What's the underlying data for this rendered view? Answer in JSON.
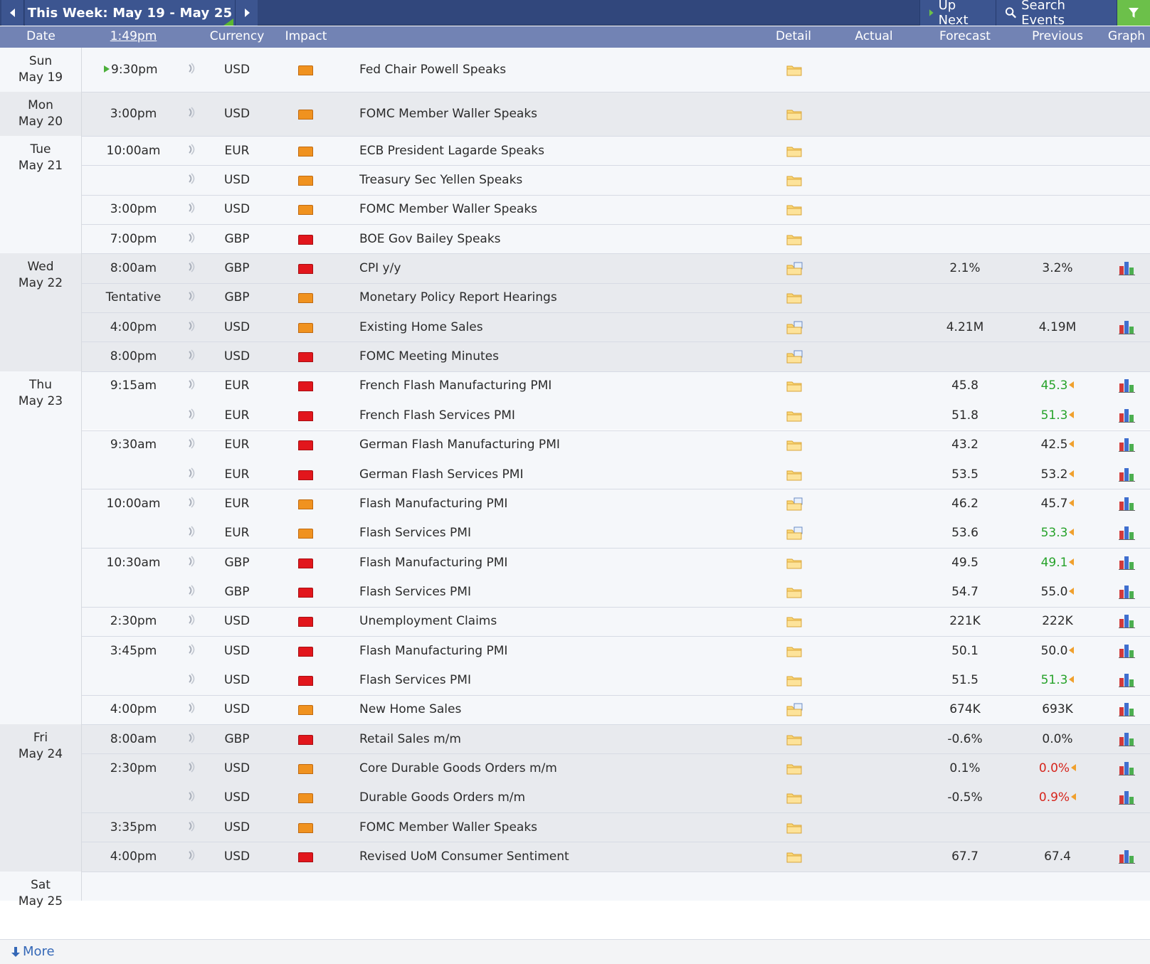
{
  "toolbar": {
    "week_title": "This Week: May 19 - May 25",
    "up_next_label": "Up Next",
    "search_label": "Search Events",
    "colors": {
      "bar": "#31477c",
      "filter": "#6cc04a",
      "header": "#7283b4"
    }
  },
  "header": {
    "date": "Date",
    "time": "1:49pm",
    "currency": "Currency",
    "impact": "Impact",
    "detail": "Detail",
    "actual": "Actual",
    "forecast": "Forecast",
    "previous": "Previous",
    "graph": "Graph"
  },
  "days": [
    {
      "dow": "Sun",
      "date": "May 19"
    },
    {
      "dow": "Mon",
      "date": "May 20"
    },
    {
      "dow": "Tue",
      "date": "May 21"
    },
    {
      "dow": "Wed",
      "date": "May 22"
    },
    {
      "dow": "Thu",
      "date": "May 23"
    },
    {
      "dow": "Fri",
      "date": "May 24"
    },
    {
      "dow": "Sat",
      "date": "May 25"
    }
  ],
  "events": [
    {
      "time": "9:30pm",
      "upcoming": true,
      "currency": "USD",
      "impact": "medium",
      "title": "Fed Chair Powell Speaks",
      "forecast": "",
      "previous": "",
      "previous_color": "",
      "revised": false,
      "graph": false
    },
    {
      "time": "3:00pm",
      "currency": "USD",
      "impact": "medium",
      "title": "FOMC Member Waller Speaks",
      "forecast": "",
      "previous": "",
      "previous_color": "",
      "revised": false,
      "graph": false
    },
    {
      "time": "10:00am",
      "currency": "EUR",
      "impact": "medium",
      "title": "ECB President Lagarde Speaks",
      "forecast": "",
      "previous": "",
      "previous_color": "",
      "revised": false,
      "graph": false
    },
    {
      "time": "",
      "currency": "USD",
      "impact": "medium",
      "title": "Treasury Sec Yellen Speaks",
      "forecast": "",
      "previous": "",
      "previous_color": "",
      "revised": false,
      "graph": false
    },
    {
      "time": "3:00pm",
      "currency": "USD",
      "impact": "medium",
      "title": "FOMC Member Waller Speaks",
      "forecast": "",
      "previous": "",
      "previous_color": "",
      "revised": false,
      "graph": false
    },
    {
      "time": "7:00pm",
      "currency": "GBP",
      "impact": "high",
      "title": "BOE Gov Bailey Speaks",
      "forecast": "",
      "previous": "",
      "previous_color": "",
      "revised": false,
      "graph": false
    },
    {
      "time": "8:00am",
      "currency": "GBP",
      "impact": "high",
      "title": "CPI y/y",
      "forecast": "2.1%",
      "previous": "3.2%",
      "previous_color": "",
      "revised": false,
      "graph": true
    },
    {
      "time": "Tentative",
      "currency": "GBP",
      "impact": "medium",
      "title": "Monetary Policy Report Hearings",
      "forecast": "",
      "previous": "",
      "previous_color": "",
      "revised": false,
      "graph": false
    },
    {
      "time": "4:00pm",
      "currency": "USD",
      "impact": "medium",
      "title": "Existing Home Sales",
      "forecast": "4.21M",
      "previous": "4.19M",
      "previous_color": "",
      "revised": false,
      "graph": true
    },
    {
      "time": "8:00pm",
      "currency": "USD",
      "impact": "high",
      "title": "FOMC Meeting Minutes",
      "forecast": "",
      "previous": "",
      "previous_color": "",
      "revised": false,
      "graph": false
    },
    {
      "time": "9:15am",
      "currency": "EUR",
      "impact": "high",
      "title": "French Flash Manufacturing PMI",
      "forecast": "45.8",
      "previous": "45.3",
      "previous_color": "green",
      "revised": true,
      "graph": true
    },
    {
      "time": "",
      "currency": "EUR",
      "impact": "high",
      "title": "French Flash Services PMI",
      "forecast": "51.8",
      "previous": "51.3",
      "previous_color": "green",
      "revised": true,
      "graph": true
    },
    {
      "time": "9:30am",
      "currency": "EUR",
      "impact": "high",
      "title": "German Flash Manufacturing PMI",
      "forecast": "43.2",
      "previous": "42.5",
      "previous_color": "",
      "revised": true,
      "graph": true
    },
    {
      "time": "",
      "currency": "EUR",
      "impact": "high",
      "title": "German Flash Services PMI",
      "forecast": "53.5",
      "previous": "53.2",
      "previous_color": "",
      "revised": true,
      "graph": true
    },
    {
      "time": "10:00am",
      "currency": "EUR",
      "impact": "medium",
      "title": "Flash Manufacturing PMI",
      "forecast": "46.2",
      "previous": "45.7",
      "previous_color": "",
      "revised": true,
      "graph": true
    },
    {
      "time": "",
      "currency": "EUR",
      "impact": "medium",
      "title": "Flash Services PMI",
      "forecast": "53.6",
      "previous": "53.3",
      "previous_color": "green",
      "revised": true,
      "graph": true
    },
    {
      "time": "10:30am",
      "currency": "GBP",
      "impact": "high",
      "title": "Flash Manufacturing PMI",
      "forecast": "49.5",
      "previous": "49.1",
      "previous_color": "green",
      "revised": true,
      "graph": true
    },
    {
      "time": "",
      "currency": "GBP",
      "impact": "high",
      "title": "Flash Services PMI",
      "forecast": "54.7",
      "previous": "55.0",
      "previous_color": "",
      "revised": true,
      "graph": true
    },
    {
      "time": "2:30pm",
      "currency": "USD",
      "impact": "high",
      "title": "Unemployment Claims",
      "forecast": "221K",
      "previous": "222K",
      "previous_color": "",
      "revised": false,
      "graph": true
    },
    {
      "time": "3:45pm",
      "currency": "USD",
      "impact": "high",
      "title": "Flash Manufacturing PMI",
      "forecast": "50.1",
      "previous": "50.0",
      "previous_color": "",
      "revised": true,
      "graph": true
    },
    {
      "time": "",
      "currency": "USD",
      "impact": "high",
      "title": "Flash Services PMI",
      "forecast": "51.5",
      "previous": "51.3",
      "previous_color": "green",
      "revised": true,
      "graph": true
    },
    {
      "time": "4:00pm",
      "currency": "USD",
      "impact": "medium",
      "title": "New Home Sales",
      "forecast": "674K",
      "previous": "693K",
      "previous_color": "",
      "revised": false,
      "graph": true
    },
    {
      "time": "8:00am",
      "currency": "GBP",
      "impact": "high",
      "title": "Retail Sales m/m",
      "forecast": "-0.6%",
      "previous": "0.0%",
      "previous_color": "",
      "revised": false,
      "graph": true
    },
    {
      "time": "2:30pm",
      "currency": "USD",
      "impact": "medium",
      "title": "Core Durable Goods Orders m/m",
      "forecast": "0.1%",
      "previous": "0.0%",
      "previous_color": "red",
      "revised": true,
      "graph": true
    },
    {
      "time": "",
      "currency": "USD",
      "impact": "medium",
      "title": "Durable Goods Orders m/m",
      "forecast": "-0.5%",
      "previous": "0.9%",
      "previous_color": "red",
      "revised": true,
      "graph": true
    },
    {
      "time": "3:35pm",
      "currency": "USD",
      "impact": "medium",
      "title": "FOMC Member Waller Speaks",
      "forecast": "",
      "previous": "",
      "previous_color": "",
      "revised": false,
      "graph": false
    },
    {
      "time": "4:00pm",
      "currency": "USD",
      "impact": "high",
      "title": "Revised UoM Consumer Sentiment",
      "forecast": "67.7",
      "previous": "67.4",
      "previous_color": "",
      "revised": false,
      "graph": true
    }
  ],
  "footer": {
    "more_label": "More"
  }
}
